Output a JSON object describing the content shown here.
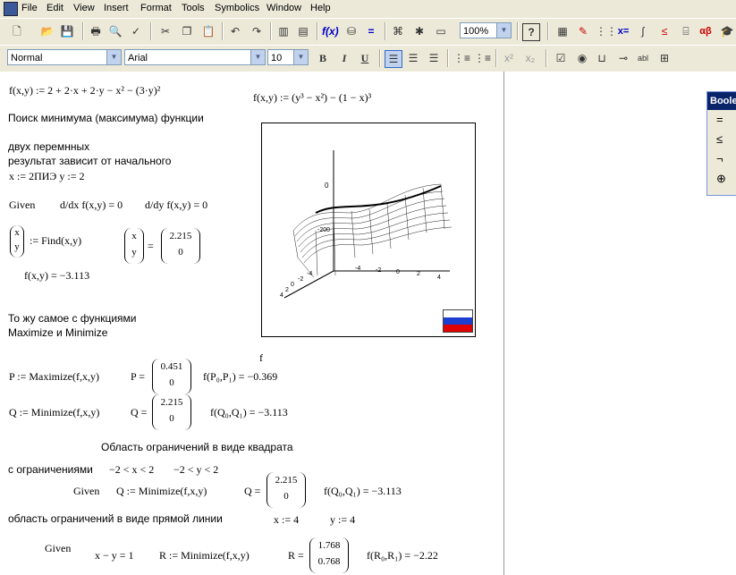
{
  "menu": [
    "File",
    "Edit",
    "View",
    "Insert",
    "Format",
    "Tools",
    "Symbolics",
    "Window",
    "Help"
  ],
  "toolbar": {
    "zoom": "100%",
    "style": "Normal",
    "font": "Arial",
    "size": "10"
  },
  "format_buttons": {
    "bold": "B",
    "italic": "I",
    "underline": "U"
  },
  "math_buttons": {
    "eval": "x=",
    "alpha": "αβ"
  },
  "boole": {
    "title": "Boolean",
    "items": [
      "=",
      "≤",
      "¬",
      "⊕"
    ]
  },
  "sheet": {
    "f_def": "f(x,y) := 2 + 2·x + 2·y − x² − (3·y)²",
    "f_def2": "f(x,y) := (y³ − x²) − (1 − x)³",
    "text1": "Поиск минимума (максимума) функции",
    "text2": "двух перемнных",
    "text3": "результат зависит от начального",
    "init": "x := 2ПИЭ y := 2",
    "given": "Given",
    "deriv_x": "d/dx f(x,y) = 0",
    "deriv_y": "d/dy f(x,y) = 0",
    "find": ":= Find(x,y)",
    "find_lhs": [
      "x",
      "y"
    ],
    "xy_vec": [
      "x",
      "y"
    ],
    "xy_vals": [
      "2.215",
      "0"
    ],
    "f_val": "f(x,y) = −3.113",
    "text4": "То жу самое с функциями",
    "text5": "Maximize и Minimize",
    "f_label": "f",
    "p_def": "P := Maximize(f,x,y)",
    "p_eq": "P =",
    "p_vals": [
      "0.451",
      "0"
    ],
    "f_p": "f(P₀,P₁) = −0.369",
    "q_def": "Q := Minimize(f,x,y)",
    "q_eq": "Q =",
    "q_vals": [
      "2.215",
      "0"
    ],
    "f_q": "f(Q₀,Q₁) = −3.113",
    "text6": "Область ограничений в виде квадрата",
    "text7": "с ограничениями",
    "constr1": "−2 < x < 2",
    "constr2": "−2 < y < 2",
    "given2": "Given",
    "q2_def": "Q := Minimize(f,x,y)",
    "q2_eq": "Q =",
    "q2_vals": [
      "2.215",
      "0"
    ],
    "f_q2": "f(Q₀,Q₁) = −3.113",
    "text8": "область ограничений в виде прямой линии",
    "x4": "x := 4",
    "y4": "y := 4",
    "given3": "Given",
    "line_eq": "x − y = 1",
    "r_def": "R := Minimize(f,x,y)",
    "r_eq": "R =",
    "r_vals": [
      "1.768",
      "0.768"
    ],
    "f_r": "f(R₀,R₁) = −2.22"
  },
  "plot": {
    "z0": "0",
    "z_neg": "-200",
    "ax1": [
      "-4",
      "-2",
      "0",
      "2",
      "4"
    ],
    "ax2": [
      "-4",
      "-2",
      "0",
      "2",
      "4"
    ]
  },
  "colors": {
    "flag_white": "#ffffff",
    "flag_blue": "#1c3fd0",
    "flag_red": "#e00000",
    "toolbar": "#ece9d8"
  }
}
